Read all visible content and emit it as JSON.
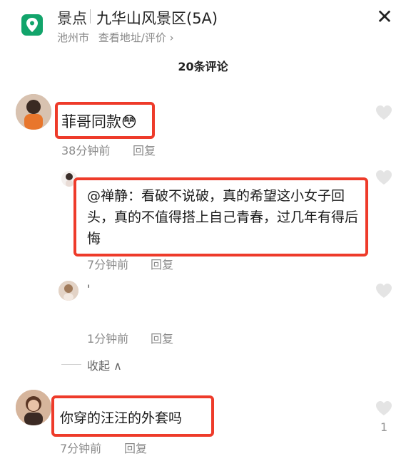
{
  "header": {
    "poi_type": "景点",
    "poi_name": "九华山风景区(5A)",
    "city": "池州市",
    "view_link": "查看地址/评价 ›",
    "close_glyph": "✕"
  },
  "comment_count": "20条评论",
  "comments": [
    {
      "text": "菲哥同款",
      "emoji": "😳",
      "time": "38分钟前",
      "reply_label": "回复"
    },
    {
      "text": "@禅静：看破不说破，真的希望这小女子回头，真的不值得搭上自己青春，过几年有得后悔",
      "time": "7分钟前",
      "reply_label": "回复"
    },
    {
      "text": "'",
      "time": "1分钟前",
      "reply_label": "回复"
    },
    {
      "text": "你穿的汪汪的外套吗",
      "time": "7分钟前",
      "reply_label": "回复",
      "likes": "1"
    }
  ],
  "collapse_label": "收起 ∧",
  "colors": {
    "highlight": "#ee3b2a",
    "icon_green": "#12a46b",
    "meta_gray": "#8a8a8a"
  },
  "icons": [
    "location-pin-icon",
    "close-icon",
    "heart-icon"
  ]
}
